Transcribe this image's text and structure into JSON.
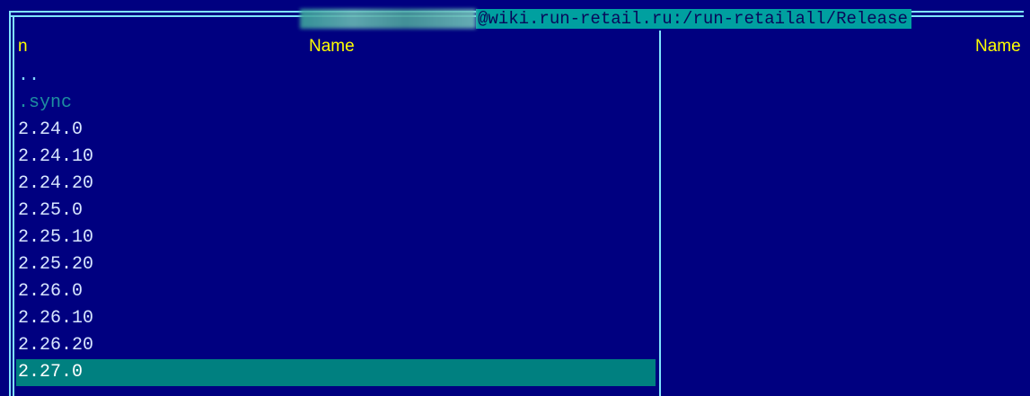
{
  "title": {
    "path": "@wiki.run-retail.ru:/run-retailall/Release"
  },
  "left_panel": {
    "header_n": "n",
    "header_name": "Name",
    "items": [
      {
        "label": ".."
      },
      {
        "label": ".sync"
      },
      {
        "label": "2.24.0"
      },
      {
        "label": "2.24.10"
      },
      {
        "label": "2.24.20"
      },
      {
        "label": "2.25.0"
      },
      {
        "label": "2.25.10"
      },
      {
        "label": "2.25.20"
      },
      {
        "label": "2.26.0"
      },
      {
        "label": "2.26.10"
      },
      {
        "label": "2.26.20"
      },
      {
        "label": "2.27.0"
      }
    ],
    "selected_index": 11
  },
  "right_panel": {
    "header_name": "Name"
  },
  "colors": {
    "background": "#000080",
    "frame": "#7fe4ff",
    "header_text": "#ffff00",
    "selection": "#008080",
    "title_bg": "#00a0a0"
  }
}
